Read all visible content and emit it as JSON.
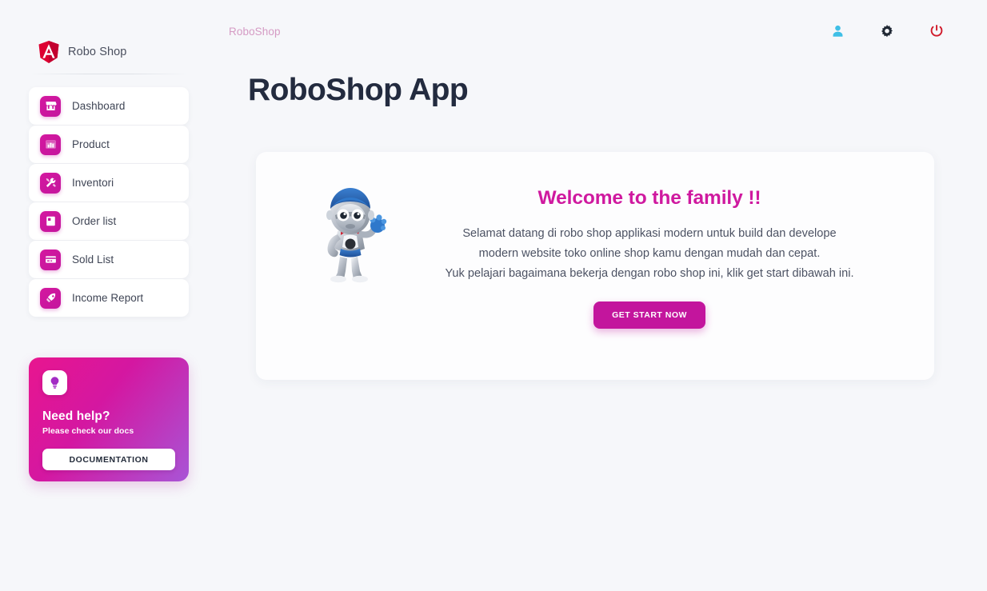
{
  "brand": {
    "name": "Robo Shop",
    "logo_icon": "angular-shield-logo",
    "logo_letter": "A",
    "logo_color": "#dd0031"
  },
  "sidebar": {
    "items": [
      {
        "label": "Dashboard",
        "icon": "store-icon"
      },
      {
        "label": "Product",
        "icon": "bar-chart-icon"
      },
      {
        "label": "Inventori",
        "icon": "tools-icon"
      },
      {
        "label": "Order list",
        "icon": "document-icon"
      },
      {
        "label": "Sold List",
        "icon": "credit-card-icon"
      },
      {
        "label": "Income Report",
        "icon": "rocket-icon"
      }
    ],
    "help_card": {
      "icon": "lightbulb-icon",
      "title": "Need help?",
      "subtitle": "Please check our docs",
      "button_label": "DOCUMENTATION",
      "gradient_start": "#e8168f",
      "gradient_end": "#a855d6"
    }
  },
  "topbar": {
    "breadcrumb": "RoboShop",
    "actions": [
      {
        "name": "profile-icon",
        "color": "#3fbfe6"
      },
      {
        "name": "gear-icon",
        "color": "#1f2733"
      },
      {
        "name": "power-icon",
        "color": "#d01a2a"
      }
    ]
  },
  "main": {
    "page_title": "RoboShop App",
    "welcome": {
      "mascot": "robot-mascot-image",
      "heading": "Welcome to the family !!",
      "line1": "Selamat datang di robo shop applikasi modern untuk build dan develope",
      "line2": "modern website toko online shop kamu dengan mudah dan cepat.",
      "line3": "Yuk pelajari bagaimana bekerja dengan robo shop ini, klik get start dibawah ini.",
      "cta_label": "GET START NOW",
      "heading_color": "#cf199f",
      "cta_color": "#c3159d"
    }
  }
}
